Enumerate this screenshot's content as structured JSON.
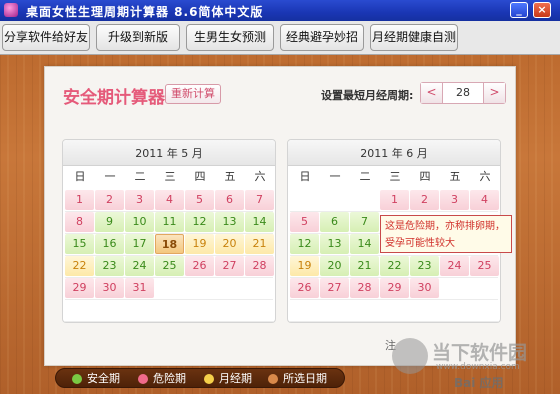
{
  "window": {
    "title": "桌面女性生理周期计算器 8.6简体中文版",
    "min_label": "_",
    "close_label": "×"
  },
  "toolbar": {
    "items": [
      "分享软件给好友",
      "升级到新版",
      "生男生女预测",
      "经典避孕妙招",
      "月经期健康自测"
    ]
  },
  "panel": {
    "title": "安全期计算器",
    "recalc_label": "重新计算",
    "cycle_label": "设置最短月经周期:",
    "cycle_value": "28",
    "dec_label": "<",
    "inc_label": ">"
  },
  "weekdays": [
    "日",
    "一",
    "二",
    "三",
    "四",
    "五",
    "六"
  ],
  "calendars": [
    {
      "title": "2011 年 5 月",
      "rows": [
        [
          [
            "1",
            "d"
          ],
          [
            "2",
            "d"
          ],
          [
            "3",
            "d"
          ],
          [
            "4",
            "d"
          ],
          [
            "5",
            "d"
          ],
          [
            "6",
            "d"
          ],
          [
            "7",
            "d"
          ]
        ],
        [
          [
            "8",
            "d"
          ],
          [
            "9",
            "s"
          ],
          [
            "10",
            "s"
          ],
          [
            "11",
            "s"
          ],
          [
            "12",
            "s"
          ],
          [
            "13",
            "s"
          ],
          [
            "14",
            "s"
          ]
        ],
        [
          [
            "15",
            "s"
          ],
          [
            "16",
            "s"
          ],
          [
            "17",
            "s"
          ],
          [
            "18",
            "t"
          ],
          [
            "19",
            "p"
          ],
          [
            "20",
            "p"
          ],
          [
            "21",
            "p"
          ]
        ],
        [
          [
            "22",
            "p"
          ],
          [
            "23",
            "s"
          ],
          [
            "24",
            "s"
          ],
          [
            "25",
            "s"
          ],
          [
            "26",
            "d"
          ],
          [
            "27",
            "d"
          ],
          [
            "28",
            "d"
          ]
        ],
        [
          [
            "29",
            "d"
          ],
          [
            "30",
            "d"
          ],
          [
            "31",
            "d"
          ],
          [
            "",
            ""
          ],
          [
            "",
            ""
          ],
          [
            "",
            ""
          ],
          [
            "",
            ""
          ]
        ],
        [
          [
            "",
            ""
          ],
          [
            "",
            ""
          ],
          [
            "",
            ""
          ],
          [
            "",
            ""
          ],
          [
            "",
            ""
          ],
          [
            "",
            ""
          ],
          [
            "",
            ""
          ]
        ]
      ]
    },
    {
      "title": "2011 年 6 月",
      "rows": [
        [
          [
            "",
            ""
          ],
          [
            "",
            ""
          ],
          [
            "",
            ""
          ],
          [
            "1",
            "d"
          ],
          [
            "2",
            "d"
          ],
          [
            "3",
            "d"
          ],
          [
            "4",
            "d"
          ]
        ],
        [
          [
            "5",
            "d"
          ],
          [
            "6",
            "s"
          ],
          [
            "7",
            "s"
          ],
          [
            "",
            ""
          ],
          [
            "",
            ""
          ],
          [
            "",
            ""
          ],
          [
            "",
            ""
          ]
        ],
        [
          [
            "12",
            "s"
          ],
          [
            "13",
            "s"
          ],
          [
            "14",
            "s"
          ],
          [
            "",
            ""
          ],
          [
            "",
            ""
          ],
          [
            "",
            ""
          ],
          [
            "",
            ""
          ]
        ],
        [
          [
            "19",
            "p"
          ],
          [
            "20",
            "s"
          ],
          [
            "21",
            "s"
          ],
          [
            "22",
            "s"
          ],
          [
            "23",
            "s"
          ],
          [
            "24",
            "d"
          ],
          [
            "25",
            "d"
          ]
        ],
        [
          [
            "26",
            "d"
          ],
          [
            "27",
            "d"
          ],
          [
            "28",
            "d"
          ],
          [
            "29",
            "d"
          ],
          [
            "30",
            "d"
          ],
          [
            "",
            ""
          ],
          [
            "",
            ""
          ]
        ],
        [
          [
            "",
            ""
          ],
          [
            "",
            ""
          ],
          [
            "",
            ""
          ],
          [
            "",
            ""
          ],
          [
            "",
            ""
          ],
          [
            "",
            ""
          ],
          [
            "",
            ""
          ]
        ]
      ]
    }
  ],
  "tooltip": {
    "line1": "这是危险期，亦称排卵期，",
    "line2": "受孕可能性较大"
  },
  "legend": [
    {
      "label": "安全期",
      "color": "#7ac943"
    },
    {
      "label": "危险期",
      "color": "#f06a8a"
    },
    {
      "label": "月经期",
      "color": "#f5d04a"
    },
    {
      "label": "所选日期",
      "color": "#d9894a"
    }
  ],
  "footnote": "注",
  "watermark": {
    "brand": "当下软件园",
    "sub": "www.downxia.com",
    "baidu": "Bai 应用"
  },
  "colors": {
    "title_pink": "#e55a7a",
    "safe_green": "#7ac943",
    "danger_pink": "#f06a8a",
    "period_yellow": "#f5d04a"
  }
}
